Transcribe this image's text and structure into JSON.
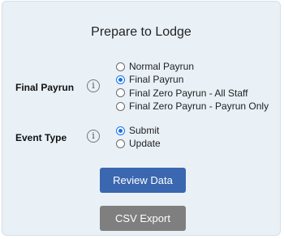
{
  "title": "Prepare to Lodge",
  "final_payrun": {
    "label": "Final Payrun",
    "info_icon": "info-icon",
    "options": [
      {
        "label": "Normal Payrun",
        "selected": false
      },
      {
        "label": "Final Payrun",
        "selected": true
      },
      {
        "label": "Final Zero Payrun - All Staff",
        "selected": false
      },
      {
        "label": "Final Zero Payrun - Payrun Only",
        "selected": false
      }
    ]
  },
  "event_type": {
    "label": "Event Type",
    "info_icon": "info-icon",
    "options": [
      {
        "label": "Submit",
        "selected": true
      },
      {
        "label": "Update",
        "selected": false
      }
    ]
  },
  "buttons": {
    "review_label": "Review Data",
    "csv_label": "CSV Export"
  },
  "colors": {
    "panel_background": "#e9f1f7",
    "review_button": "#3a67b0",
    "csv_button": "#7f7f7f",
    "radio_selected": "#1a73e8"
  }
}
